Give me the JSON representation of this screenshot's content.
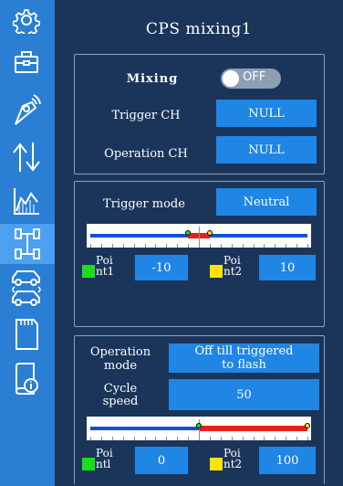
{
  "page": {
    "title": "CPS mixing1"
  },
  "sidebar": {
    "items": [
      {
        "icon": "gear-icon"
      },
      {
        "icon": "toolbox-icon"
      },
      {
        "icon": "transmitter-icon"
      },
      {
        "icon": "reverse-arrows-icon"
      },
      {
        "icon": "curve-graph-icon"
      },
      {
        "icon": "chassis-mixing-icon",
        "active": true
      },
      {
        "icon": "car-swap-icon"
      },
      {
        "icon": "sd-card-icon"
      },
      {
        "icon": "info-icon"
      }
    ]
  },
  "section1": {
    "mixing_label": "Mixing",
    "mixing_state": "OFF",
    "trigger_ch_label": "Trigger CH",
    "trigger_ch_value": "NULL",
    "operation_ch_label": "Operation CH",
    "operation_ch_value": "NULL"
  },
  "section2": {
    "trigger_mode_label": "Trigger mode",
    "trigger_mode_value": "Neutral",
    "slider": {
      "point1": -10,
      "point2": 10,
      "min": -100,
      "max": 100
    },
    "point1_label_a": "Poi",
    "point1_label_b": "nt1",
    "point1_value": "-10",
    "point2_label_a": "Poi",
    "point2_label_b": "nt2",
    "point2_value": "10"
  },
  "section3": {
    "operation_mode_label_a": "Operation",
    "operation_mode_label_b": "mode",
    "operation_mode_value_a": "Off till triggered",
    "operation_mode_value_b": "to flash",
    "cycle_speed_label_a": "Cycle",
    "cycle_speed_label_b": "speed",
    "cycle_speed_value": "50",
    "slider": {
      "point1": 0,
      "point2": 100,
      "min": -100,
      "max": 100
    },
    "point1_label_a": "Poi",
    "point1_label_b": "ntl",
    "point1_value": "0",
    "point2_label_a": "Poi",
    "point2_label_b": "nt2",
    "point2_value": "100"
  },
  "colors": {
    "sidebar": "#2a7fd4",
    "background": "#1b355a",
    "button": "#1f86e6",
    "point1_swatch": "#18e018",
    "point2_swatch": "#ffe400",
    "slider_track": "#1050d8",
    "slider_fill": "#e8201a"
  }
}
